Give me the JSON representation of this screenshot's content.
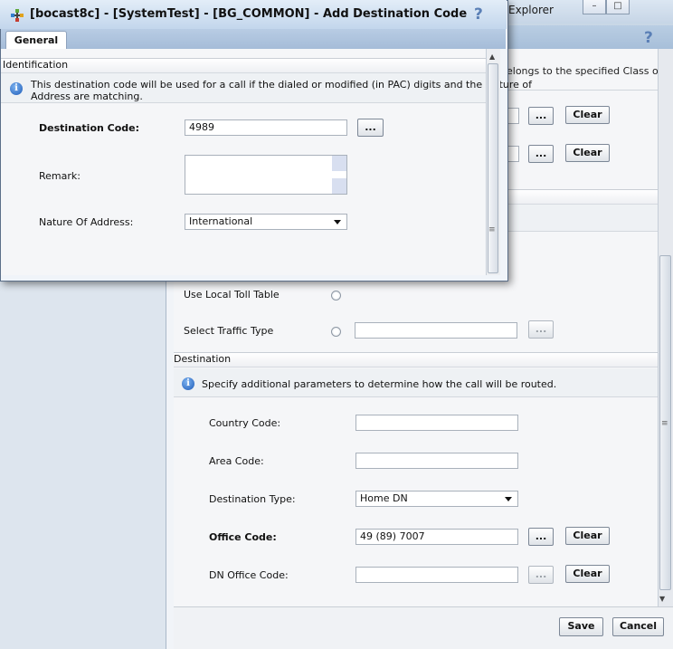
{
  "background_window": {
    "title": "Explorer",
    "help_glyph": "?",
    "truncated_text": "elongs to the specified Class of",
    "clear_label": "Clear",
    "dots_label": "...",
    "use_local_toll_label": "Use Local Toll Table",
    "select_traffic_label": "Select Traffic Type",
    "destination_section": {
      "title": "Destination",
      "info": "Specify additional parameters to determine how the call will be routed.",
      "country_code_label": "Country Code:",
      "country_code_value": "",
      "area_code_label": "Area Code:",
      "area_code_value": "",
      "destination_type_label": "Destination Type:",
      "destination_type_value": "Home DN",
      "office_code_label": "Office Code:",
      "office_code_value": "49 (89) 7007",
      "dn_office_code_label": "DN Office Code:",
      "dn_office_code_value": ""
    },
    "save_label": "Save",
    "cancel_label": "Cancel"
  },
  "dialog": {
    "title": "[bocast8c] - [SystemTest] - [BG_COMMON] - Add Destination Code",
    "help_glyph": "?",
    "tab_general": "General",
    "identification_title": "Identification",
    "info_text_line1": "This destination code will be used for a call if the dialed or modified (in PAC) digits and the Nature of",
    "info_text_line2": "Address are matching.",
    "destination_code_label": "Destination Code:",
    "destination_code_value": "4989",
    "dots_label": "...",
    "remark_label": "Remark:",
    "remark_value": "",
    "nature_label": "Nature Of Address:",
    "nature_value": "International"
  },
  "icons": [
    "app-icon",
    "info-icon",
    "help-icon",
    "minimize-icon",
    "maximize-icon",
    "chevron-down-icon"
  ]
}
